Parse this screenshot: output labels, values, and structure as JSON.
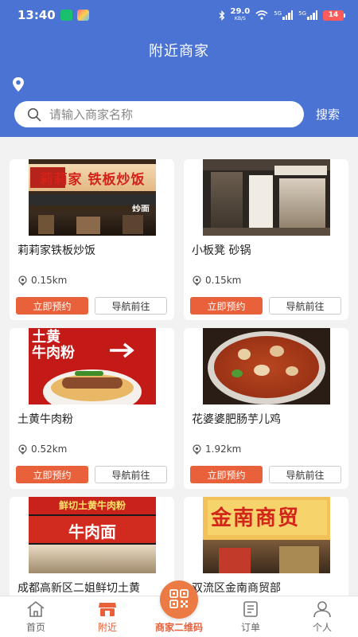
{
  "status_bar": {
    "time": "13:40",
    "net_speed": "29.0",
    "net_unit": "KB/S",
    "network_1": "5G",
    "network_2": "5G",
    "battery": "14"
  },
  "header": {
    "title": "附近商家"
  },
  "search": {
    "placeholder": "请输入商家名称",
    "button_label": "搜索"
  },
  "merchants": [
    {
      "name": "莉莉家铁板炒饭",
      "distance": "0.15km",
      "book_label": "立即预约",
      "navigate_label": "导航前往",
      "sign_text": "莉莉家 铁板炒饭",
      "sign_small": "炒面"
    },
    {
      "name": "小板凳 砂锅",
      "distance": "0.15km",
      "book_label": "立即预约",
      "navigate_label": "导航前往"
    },
    {
      "name": "土黄牛肉粉",
      "distance": "0.52km",
      "book_label": "立即预约",
      "navigate_label": "导航前往",
      "sign_text_1": "土黄",
      "sign_text_2": "牛肉粉"
    },
    {
      "name": "花婆婆肥肠芋儿鸡",
      "distance": "1.92km",
      "book_label": "立即预约",
      "navigate_label": "导航前往"
    },
    {
      "name": "成都高新区二姐鲜切土黄",
      "sign_text_1": "鲜切土黄牛肉粉",
      "sign_text_2": "牛肉面"
    },
    {
      "name": "双流区金南商贸部",
      "sign_text_1": "金南商贸"
    }
  ],
  "tabbar": {
    "home": "首页",
    "nearby": "附近",
    "qr": "商家二维码",
    "orders": "订单",
    "profile": "个人"
  },
  "colors": {
    "header": "#4a73d4",
    "accent": "#e8613a"
  }
}
